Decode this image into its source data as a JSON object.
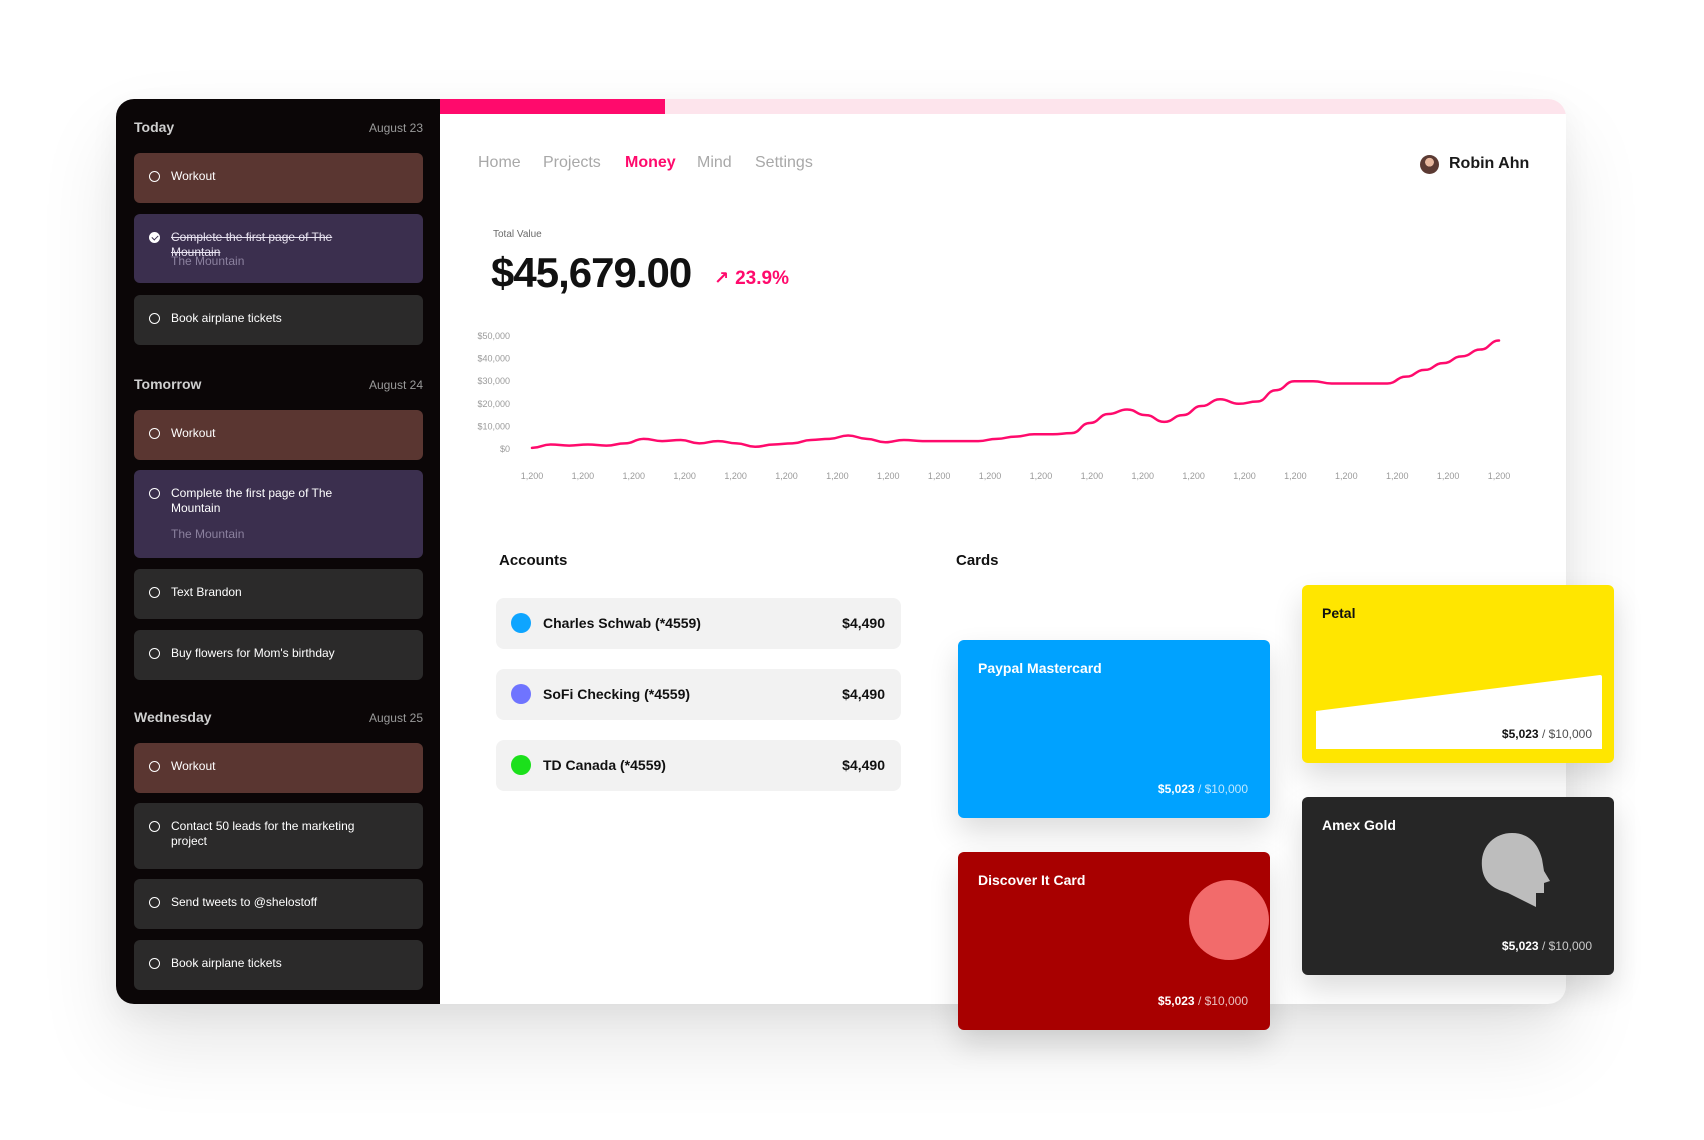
{
  "sidebar": {
    "sections": [
      {
        "title": "Today",
        "date": "August 23",
        "tasks": [
          {
            "label": "Workout"
          },
          {
            "label": "Complete the first page of The Mountain",
            "sub": "The Mountain",
            "done": true
          },
          {
            "label": "Book airplane tickets"
          }
        ]
      },
      {
        "title": "Tomorrow",
        "date": "August 24",
        "tasks": [
          {
            "label": "Workout"
          },
          {
            "label": "Complete the first page of The Mountain",
            "sub": "The Mountain"
          },
          {
            "label": "Text Brandon"
          },
          {
            "label": "Buy flowers for Mom's birthday"
          }
        ]
      },
      {
        "title": "Wednesday",
        "date": "August 25",
        "tasks": [
          {
            "label": "Workout"
          },
          {
            "label": "Contact 50 leads for the marketing project"
          },
          {
            "label": "Send tweets to @shelostoff"
          },
          {
            "label": "Book airplane tickets"
          }
        ]
      }
    ]
  },
  "progress": {
    "value_percent": 20
  },
  "nav": {
    "items": [
      {
        "label": "Home",
        "active": false
      },
      {
        "label": "Projects",
        "active": false
      },
      {
        "label": "Money",
        "active": true
      },
      {
        "label": "Mind",
        "active": false
      },
      {
        "label": "Settings",
        "active": false
      }
    ]
  },
  "user": {
    "name": "Robin Ahn",
    "avatar_icon": "user-avatar"
  },
  "summary": {
    "label": "Total Value",
    "value": "$45,679.00",
    "change": "23.9%",
    "change_icon": "arrow-up-right-icon"
  },
  "chart_data": {
    "type": "line",
    "color": "#ff0a6c",
    "yticks": [
      "$50,000",
      "$40,000",
      "$30,000",
      "$20,000",
      "$10,000",
      "$0"
    ],
    "ylim": [
      0,
      50000
    ],
    "xticks": [
      "1,200",
      "1,200",
      "1,200",
      "1,200",
      "1,200",
      "1,200",
      "1,200",
      "1,200",
      "1,200",
      "1,200",
      "1,200",
      "1,200",
      "1,200",
      "1,200",
      "1,200",
      "1,200",
      "1,200",
      "1,200",
      "1,200",
      "1,200"
    ],
    "grid": false,
    "series": [
      {
        "values": [
          500,
          2000,
          1500,
          2000,
          1500,
          2500,
          4500,
          3500,
          4000,
          2500,
          3500,
          2500,
          1000,
          2000,
          2500,
          4000,
          4500,
          6000,
          4500,
          3000,
          4000,
          3500,
          3500,
          3500,
          3500,
          4500,
          5500,
          6500,
          6500,
          7000,
          11500,
          15500,
          17500,
          15000,
          12000,
          15000,
          19000,
          22000,
          20000,
          21000,
          26000,
          30000,
          30000,
          29000,
          29000,
          29000,
          29000,
          32000,
          35000,
          38000,
          41000,
          44000,
          48000
        ]
      }
    ]
  },
  "accounts": {
    "title": "Accounts",
    "items": [
      {
        "name": "Charles Schwab (*4559)",
        "amount": "$4,490",
        "color": "#0ea5ff"
      },
      {
        "name": "SoFi Checking (*4559)",
        "amount": "$4,490",
        "color": "#6f74ff"
      },
      {
        "name": "TD Canada (*4559)",
        "amount": "$4,490",
        "color": "#1be01b"
      }
    ]
  },
  "cards": {
    "title": "Cards",
    "items": [
      {
        "name": "Paypal Mastercard",
        "balance": "$5,023",
        "limit": "/ $10,000",
        "color": "#00a2ff"
      },
      {
        "name": "Discover It Card",
        "balance": "$5,023",
        "limit": "/ $10,000",
        "color": "#a80000",
        "accent": "#f26b6b"
      },
      {
        "name": "Petal",
        "balance": "$5,023",
        "limit": "/ $10,000",
        "color": "#ffe600"
      },
      {
        "name": "Amex Gold",
        "balance": "$5,023",
        "limit": "/ $10,000",
        "color": "#262626",
        "icon": "head-silhouette-icon"
      }
    ]
  }
}
